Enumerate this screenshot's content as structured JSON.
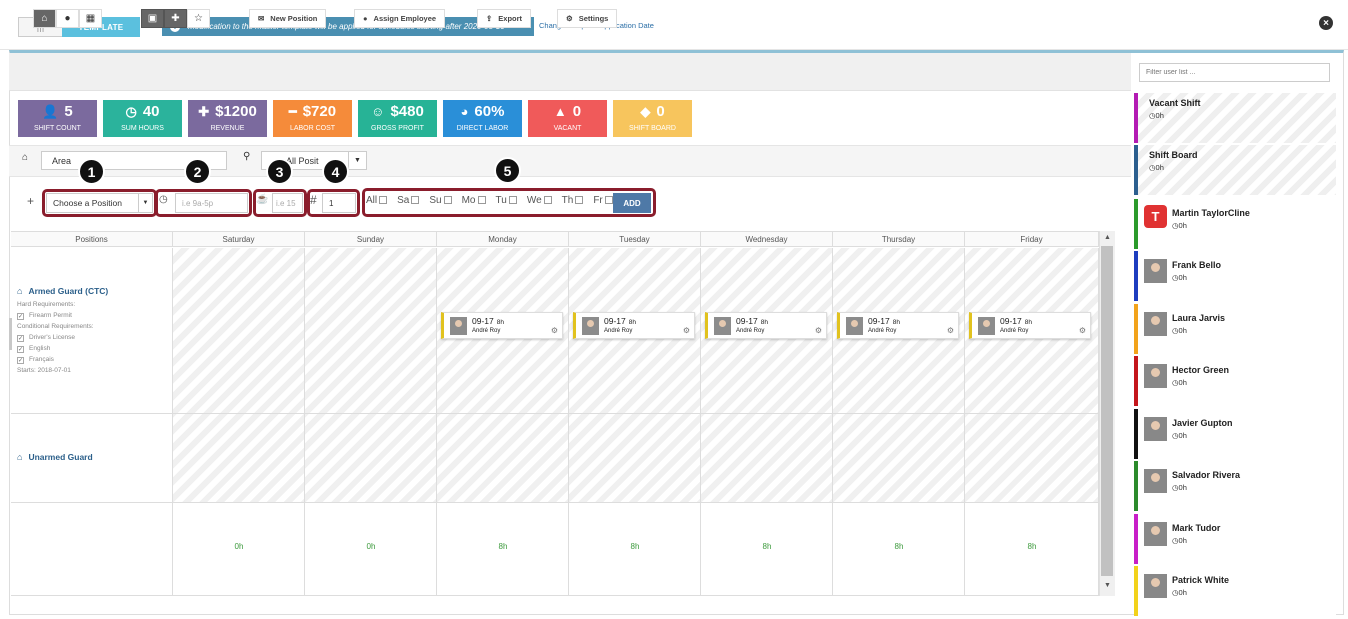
{
  "top": {
    "toggle_label": "TEMPLATE",
    "banner": "Modification to the master template will be applied for schedules starting after 2020-03-16",
    "change_link": "Change Template Application Date"
  },
  "toolbar": {
    "new_position": "New Position",
    "assign_employee": "Assign Employee",
    "export": "Export",
    "settings": "Settings",
    "filter_placeholder": "Filter user list ..."
  },
  "tiles": [
    {
      "value": "5",
      "label": "SHIFT COUNT",
      "color": "#7b6a9e",
      "icon": "user-icon"
    },
    {
      "value": "40",
      "label": "SUM HOURS",
      "color": "#2bb39c",
      "icon": "clock-icon"
    },
    {
      "value": "$1200",
      "label": "REVENUE",
      "color": "#7b6a9e",
      "icon": "plus-icon"
    },
    {
      "value": "$720",
      "label": "LABOR COST",
      "color": "#f58b3a",
      "icon": "minus-icon"
    },
    {
      "value": "$480",
      "label": "GROSS PROFIT",
      "color": "#27b396",
      "icon": "smile-icon"
    },
    {
      "value": "60%",
      "label": "DIRECT LABOR",
      "color": "#2a8fd8",
      "icon": "pie-icon"
    },
    {
      "value": "0",
      "label": "VACANT",
      "color": "#f05a5a",
      "icon": "warning-icon"
    },
    {
      "value": "0",
      "label": "SHIFT BOARD",
      "color": "#f7c55d",
      "icon": "tag-icon"
    }
  ],
  "filters": {
    "area": "Area",
    "position": "All Posit"
  },
  "add_shift": {
    "position_select": "Choose a Position",
    "time_placeholder": "i.e 9a-5p",
    "break_placeholder": "i.e 15",
    "count": "1",
    "days": [
      "All",
      "Sa",
      "Su",
      "Mo",
      "Tu",
      "We",
      "Th",
      "Fr"
    ],
    "add_label": "ADD",
    "badges": [
      "1",
      "2",
      "3",
      "4",
      "5"
    ]
  },
  "grid": {
    "headers": [
      "Positions",
      "Saturday",
      "Sunday",
      "Monday",
      "Tuesday",
      "Wednesday",
      "Thursday",
      "Friday"
    ],
    "positions": [
      {
        "title": "Armed Guard (CTC)",
        "hard_label": "Hard Requirements:",
        "hard": [
          "Firearm Permit"
        ],
        "cond_label": "Conditional Requirements:",
        "cond": [
          "Driver's License",
          "English",
          "Français"
        ],
        "starts": "Starts: 2018-07-01"
      },
      {
        "title": "Unarmed Guard"
      }
    ],
    "shift": {
      "time": "09-17",
      "hours": "8h",
      "employee": "André Roy"
    },
    "totals": [
      "0h",
      "0h",
      "8h",
      "8h",
      "8h",
      "8h",
      "8h"
    ]
  },
  "users": [
    {
      "name": "Vacant Shift",
      "hours": "0h",
      "color": "#b31bb3"
    },
    {
      "name": "Shift Board",
      "hours": "0h",
      "color": "#2c5f8f"
    },
    {
      "name": "Martin TaylorCline",
      "hours": "0h",
      "color": "#2b9a2b"
    },
    {
      "name": "Frank Bello",
      "hours": "0h",
      "color": "#1d3dbf"
    },
    {
      "name": "Laura Jarvis",
      "hours": "0h",
      "color": "#f2a31b"
    },
    {
      "name": "Hector Green",
      "hours": "0h",
      "color": "#c4161c"
    },
    {
      "name": "Javier Gupton",
      "hours": "0h",
      "color": "#111111"
    },
    {
      "name": "Salvador Rivera",
      "hours": "0h",
      "color": "#2b8a2b"
    },
    {
      "name": "Mark Tudor",
      "hours": "0h",
      "color": "#c81ec8"
    },
    {
      "name": "Patrick White",
      "hours": "0h",
      "color": "#f2d21b"
    }
  ]
}
